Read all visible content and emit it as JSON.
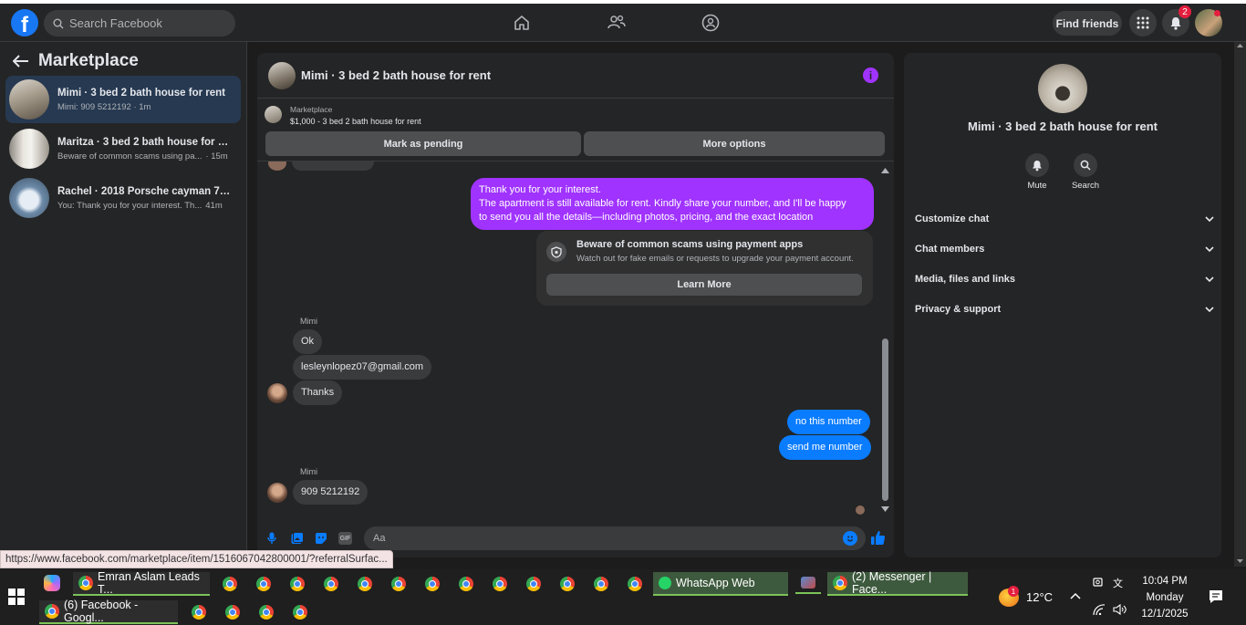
{
  "topbar": {
    "search_placeholder": "Search Facebook",
    "find_friends": "Find friends",
    "notif_count": "2"
  },
  "sidebar": {
    "title": "Marketplace",
    "conversations": [
      {
        "title": "Mimi · 3 bed 2 bath house for rent",
        "preview": "Mimi: 909 5212192 · 1m",
        "time": ""
      },
      {
        "title": "Maritza · 3 bed 2 bath house for re...",
        "preview": "Beware of common scams using pa...",
        "time": "· 15m"
      },
      {
        "title": "Rachel · 2018 Porsche cayman 718 ...",
        "preview": "You: Thank you for your interest. Th...",
        "time": "41m"
      }
    ]
  },
  "chat": {
    "title": "Mimi · 3 bed 2 bath house for rent",
    "marketplace_label": "Marketplace",
    "listing": "$1,000 - 3 bed 2 bath house for rent",
    "mark_pending": "Mark as pending",
    "more_options": "More options",
    "messages": {
      "out1_line1": "Thank you for your interest.",
      "out1_line2": "The apartment is still available for rent. Kindly share your number, and I'll be happy",
      "out1_line3": "to send you all the details—including photos, pricing, and the exact location",
      "scam_title": "Beware of common scams using payment apps",
      "scam_text": "Watch out for fake emails or requests to upgrade your payment account.",
      "learn_more": "Learn More",
      "sender1": "Mimi",
      "in1": "Ok",
      "in2": "lesleynlopez07@gmail.com",
      "in3": "Thanks",
      "out2": "no this number",
      "out3": "send me number",
      "sender2": "Mimi",
      "in4": "909 5212192"
    },
    "composer_placeholder": "Aa"
  },
  "right_panel": {
    "title": "Mimi · 3 bed 2 bath house for rent",
    "mute": "Mute",
    "search": "Search",
    "sections": [
      "Customize chat",
      "Chat members",
      "Media, files and links",
      "Privacy & support"
    ]
  },
  "status_url": "https://www.facebook.com/marketplace/item/1516067042800001/?referralSurfac...",
  "taskbar": {
    "item1": "Emran Aslam Leads T...",
    "item2": "WhatsApp Web",
    "item3": "(2) Messenger | Face...",
    "item4": "(6) Facebook - Googl...",
    "weather": "12°C",
    "weather_badge": "1",
    "time": "10:04 PM",
    "day": "Monday",
    "date": "12/1/2025"
  },
  "colors": {
    "accent_blue": "#0a7cff",
    "accent_purple": "#a033ff",
    "fb_blue": "#1877f2"
  }
}
